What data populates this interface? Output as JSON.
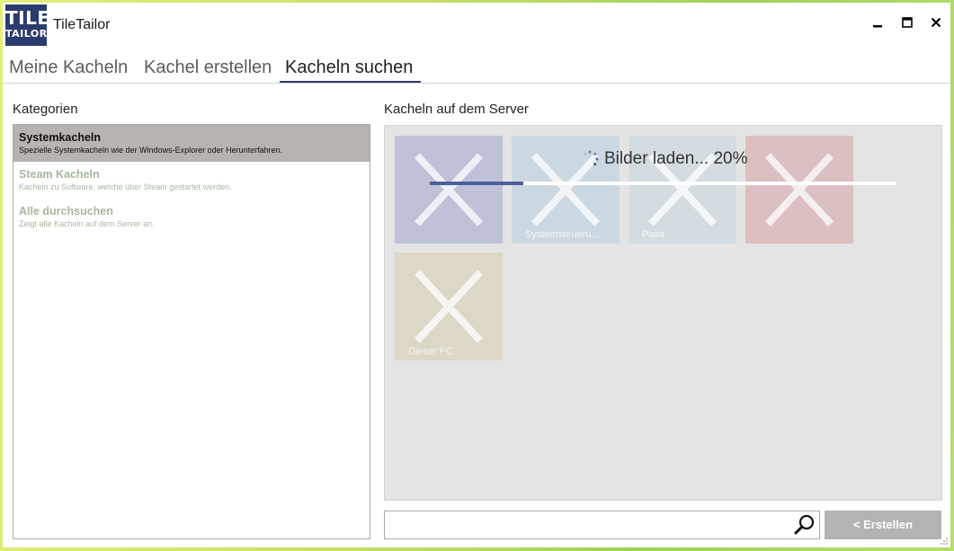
{
  "app": {
    "logo_line1": "TILE",
    "logo_line2": "TAILOR",
    "title": "TileTailor"
  },
  "window_controls": {
    "minimize_icon": "minimize-icon",
    "maximize_icon": "maximize-icon",
    "close_icon": "close-icon"
  },
  "tabs": [
    {
      "label": "Meine Kacheln",
      "active": false
    },
    {
      "label": "Kachel erstellen",
      "active": false
    },
    {
      "label": "Kacheln suchen",
      "active": true
    }
  ],
  "categories": {
    "heading": "Kategorien",
    "items": [
      {
        "title": "Systemkacheln",
        "description": "Spezielle Systemkacheln wie der Windows-Explorer oder Herunterfahren.",
        "selected": true
      },
      {
        "title": "Steam Kacheln",
        "description": "Kacheln zu Software, welche über Steam gestartet werden.",
        "selected": false
      },
      {
        "title": "Alle durchsuchen",
        "description": "Zeigt alle Kacheln auf dem Server an.",
        "selected": false
      }
    ]
  },
  "server": {
    "heading": "Kacheln auf dem Server",
    "loading_text": "Bilder laden... 20%",
    "progress": 0.2,
    "tiles": [
      {
        "label": "",
        "color": "#bfc1d8"
      },
      {
        "label": "Systemsteueru...",
        "color": "#cbd8e1"
      },
      {
        "label": "Paint",
        "color": "#d3dde1"
      },
      {
        "label": "",
        "color": "#dcc0c1"
      },
      {
        "label": "Dieser PC",
        "color": "#dcd7c6"
      }
    ]
  },
  "search": {
    "value": "",
    "placeholder": ""
  },
  "create_button": {
    "label": "< Erstellen"
  },
  "colors": {
    "accent": "#2c3b6e",
    "progress": "#4e5f9a",
    "selected_category": "#b6b3b0",
    "inactive_text": "#a6b89d",
    "button": "#b3b3b3"
  }
}
